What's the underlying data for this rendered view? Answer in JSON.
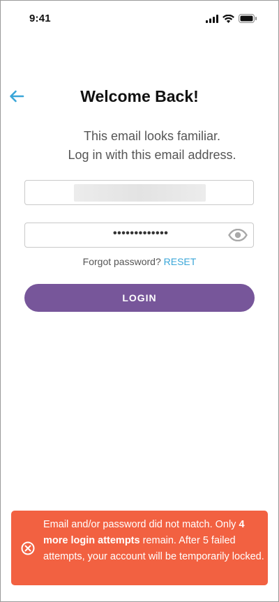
{
  "status_bar": {
    "time": "9:41"
  },
  "header": {
    "back_icon": "arrow-left-icon",
    "title": "Welcome Back!"
  },
  "subtitle": {
    "line1": "This email looks familiar.",
    "line2": "Log in with this email address."
  },
  "form": {
    "email_value_redacted": true,
    "password_masked": "•••••••••••••",
    "show_password_icon": "eye-icon",
    "forgot_text": "Forgot password?",
    "reset_label": "RESET",
    "login_label": "LOGIN"
  },
  "error_toast": {
    "icon": "close-circle-icon",
    "line_start": "Email and/or password did not match. Only ",
    "bold": "4 more login attempts",
    "line_end": " remain. After 5 failed attempts, your account will be temporarily locked."
  },
  "colors": {
    "accent": "#77569a",
    "link": "#3aa6d8",
    "back_arrow": "#3aa6d8",
    "error": "#f26141"
  }
}
